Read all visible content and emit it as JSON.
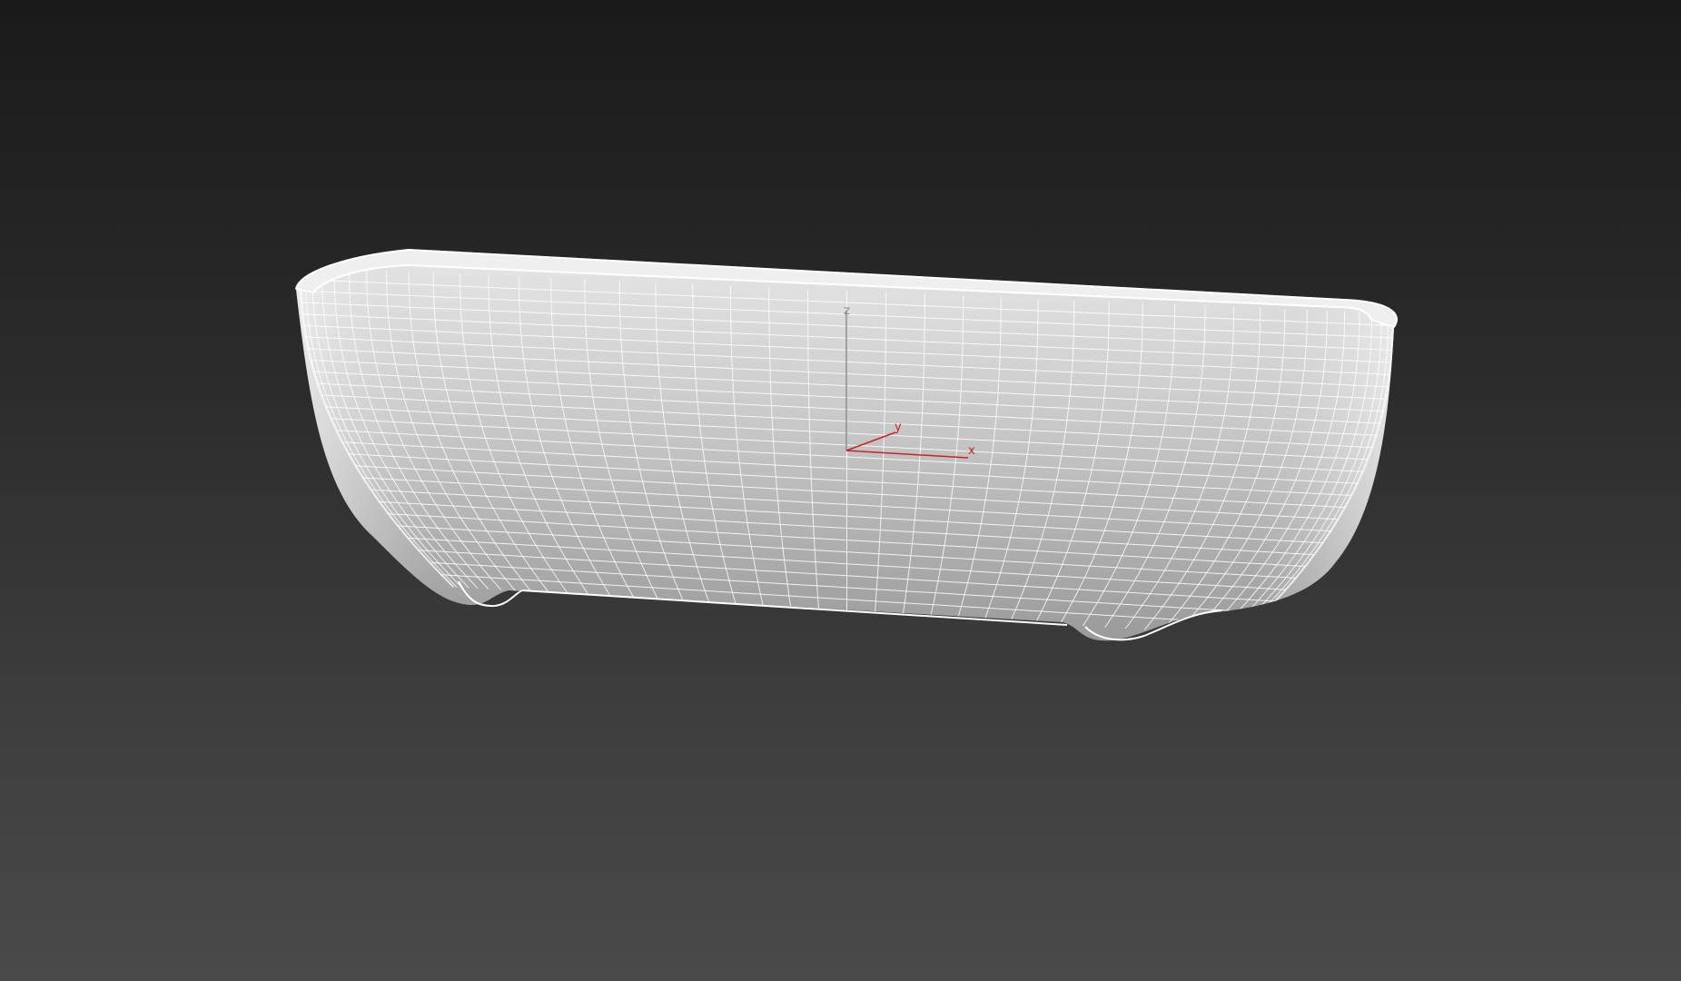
{
  "viewport": {
    "shading": "wireframe-over-shaded",
    "background_top": "#1a1a1a",
    "background_bottom": "#4a4a4a"
  },
  "model": {
    "kind": "planter-box-mesh",
    "surface_color": "#c4c4c4",
    "wire_color": "#ffffff"
  },
  "gizmo": {
    "z_label": "z",
    "y_label": "y",
    "x_label": "x",
    "z_color": "#8a8a8a",
    "xy_color": "#cc2222"
  }
}
